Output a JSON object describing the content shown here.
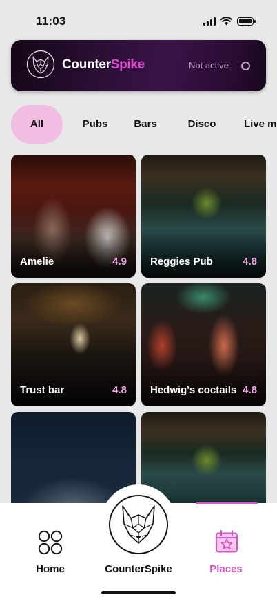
{
  "status_bar": {
    "time": "11:03"
  },
  "banner": {
    "brand_part1": "Counter",
    "brand_part2": "Spike",
    "status_text": "Not active"
  },
  "categories": [
    {
      "label": "All",
      "active": true
    },
    {
      "label": "Pubs",
      "active": false
    },
    {
      "label": "Bars",
      "active": false
    },
    {
      "label": "Disco",
      "active": false
    },
    {
      "label": "Live m",
      "active": false
    }
  ],
  "places": [
    {
      "name": "Amelie",
      "rating": "4.9"
    },
    {
      "name": "Reggies Pub",
      "rating": "4.8"
    },
    {
      "name": "Trust bar",
      "rating": "4.8"
    },
    {
      "name": "Hedwig's coctails",
      "rating": "4.8"
    },
    {
      "name": "",
      "rating": ""
    },
    {
      "name": "",
      "rating": ""
    }
  ],
  "nav": {
    "home_label": "Home",
    "center_label": "CounterSpike",
    "places_label": "Places",
    "active": "Places"
  },
  "colors": {
    "accent_pink": "#e04ad3",
    "chip_active_bg": "#f1bde3",
    "rating_pink": "#f1a6e6",
    "nav_active": "#d455c4"
  }
}
